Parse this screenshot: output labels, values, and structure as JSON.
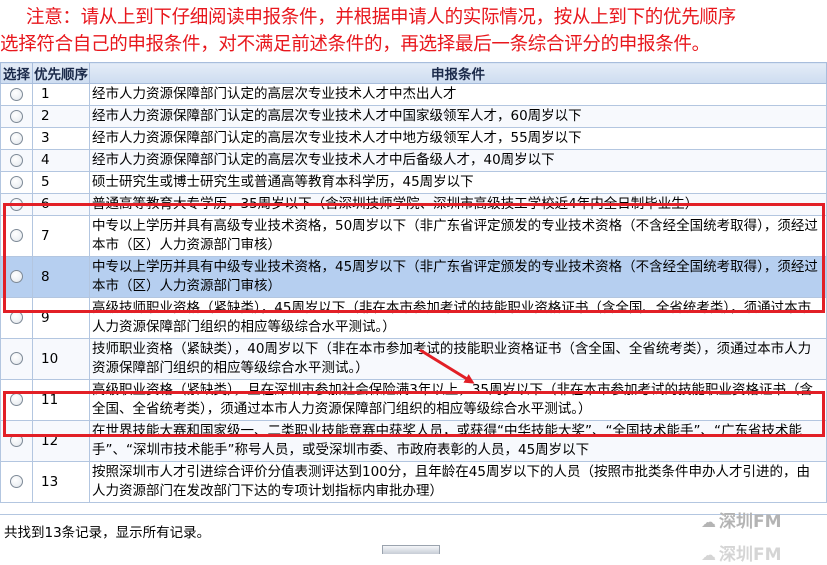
{
  "notice": {
    "line1": "注意：请从上到下仔细阅读申报条件，并根据申请人的实际情况，按从上到下的优先顺序",
    "line2": "选择符合自己的申报条件，对不满足前述条件的，再选择最后一条综合评分的申报条件。"
  },
  "table": {
    "headers": {
      "select": "选择",
      "priority": "优先顺序",
      "condition": "申报条件"
    },
    "rows": [
      {
        "no": "1",
        "text": "经市人力资源保障部门认定的高层次专业技术人才中杰出人才"
      },
      {
        "no": "2",
        "text": "经市人力资源保障部门认定的高层次专业技术人才中国家级领军人才，60周岁以下"
      },
      {
        "no": "3",
        "text": "经市人力资源保障部门认定的高层次专业技术人才中地方级领军人才，55周岁以下"
      },
      {
        "no": "4",
        "text": "经市人力资源保障部门认定的高层次专业技术人才中后备级人才，40周岁以下"
      },
      {
        "no": "5",
        "text": "硕士研究生或博士研究生或普通高等教育本科学历，45周岁以下"
      },
      {
        "no": "6",
        "text": "普通高等教育大专学历，35周岁以下（含深圳技师学院、深圳市高级技工学校近4年内全日制毕业生）"
      },
      {
        "no": "7",
        "text": "中专以上学历并具有高级专业技术资格，50周岁以下（非广东省评定颁发的专业技术资格（不含经全国统考取得），须经过本市（区）人力资源部门审核）"
      },
      {
        "no": "8",
        "text": "中专以上学历并具有中级专业技术资格，45周岁以下（非广东省评定颁发的专业技术资格（不含经全国统考取得），须经过本市（区）人力资源部门审核）"
      },
      {
        "no": "9",
        "text": "高级技师职业资格（紧缺类），45周岁以下（非在本市参加考试的技能职业资格证书（含全国、全省统考类），须通过本市人力资源保障部门组织的相应等级综合水平测试。）"
      },
      {
        "no": "10",
        "text": "技师职业资格（紧缺类），40周岁以下（非在本市参加考试的技能职业资格证书（含全国、全省统考类），须通过本市人力资源保障部门组织的相应等级综合水平测试。）"
      },
      {
        "no": "11",
        "text": "高级职业资格（紧缺类），且在深圳市参加社会保险满3年以上，35周岁以下（非在本市参加考试的技能职业资格证书（含全国、全省统考类），须通过本市人力资源保障部门组织的相应等级综合水平测试。）"
      },
      {
        "no": "12",
        "text": "在世界技能大赛和国家级一、二类职业技能竞赛中获奖人员，或获得“中华技能大奖”、“全国技术能手”、“广东省技术能手”、“深圳市技术能手”称号人员，或受深圳市委、市政府表彰的人员，45周岁以下"
      },
      {
        "no": "13",
        "text": "按照深圳市人才引进综合评价分值表测评达到100分，且年龄在45周岁以下的人员（按照市批类条件申办人才引进的，由人力资源部门在发改部门下达的专项计划指标内审批办理）"
      }
    ]
  },
  "footer": {
    "status": "共找到13条记录，显示所有记录。"
  },
  "watermark": {
    "text": "深圳FM",
    "icon": "wechat-icon"
  },
  "colors": {
    "notice": "#e8171d",
    "highlight_row": "#b6cff0",
    "red_box": "#e21f26",
    "arrow": "#e21f26"
  }
}
